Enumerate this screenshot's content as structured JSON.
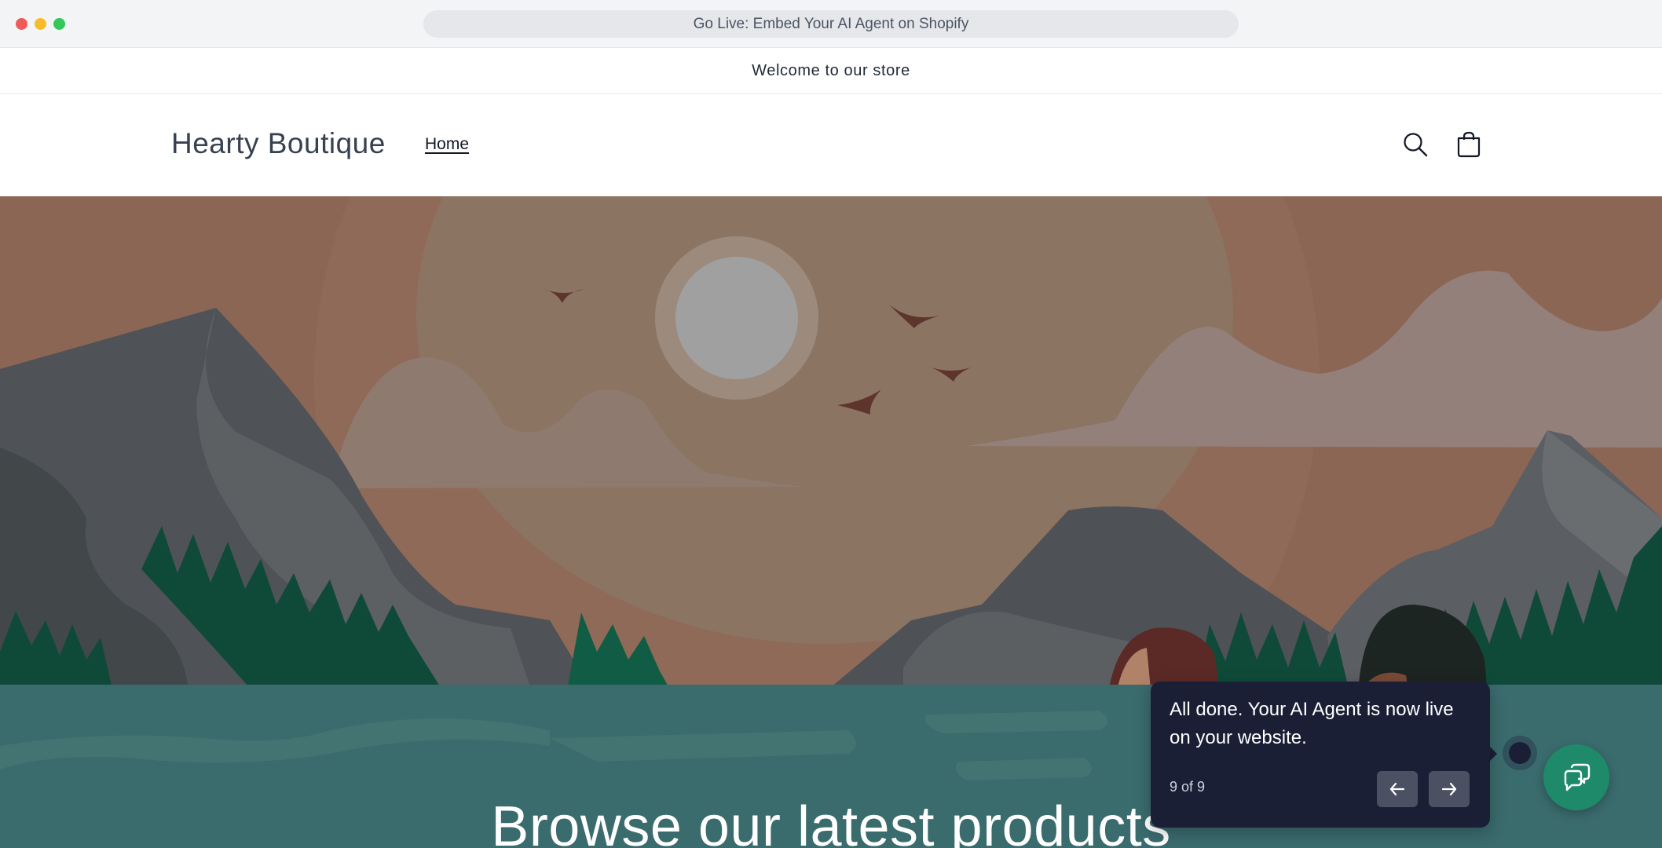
{
  "browser": {
    "tab_title": "Go Live: Embed Your AI Agent on Shopify"
  },
  "announcement": {
    "text": "Welcome to our store"
  },
  "header": {
    "logo": "Hearty Boutique",
    "nav": [
      {
        "label": "Home"
      }
    ],
    "icons": [
      "search-icon",
      "cart-icon"
    ]
  },
  "hero": {
    "title": "Browse our latest products"
  },
  "tour": {
    "message": "All done. Your AI Agent is now live on your website.",
    "step": "9 of 9",
    "prev_icon": "arrow-left-icon",
    "next_icon": "arrow-right-icon"
  },
  "chat": {
    "icon": "chat-bubbles-icon",
    "color": "#1e8a6a"
  },
  "colors": {
    "sky": "#8c6654",
    "water": "#3a6b6d",
    "tooltip": "#1b1f36"
  }
}
